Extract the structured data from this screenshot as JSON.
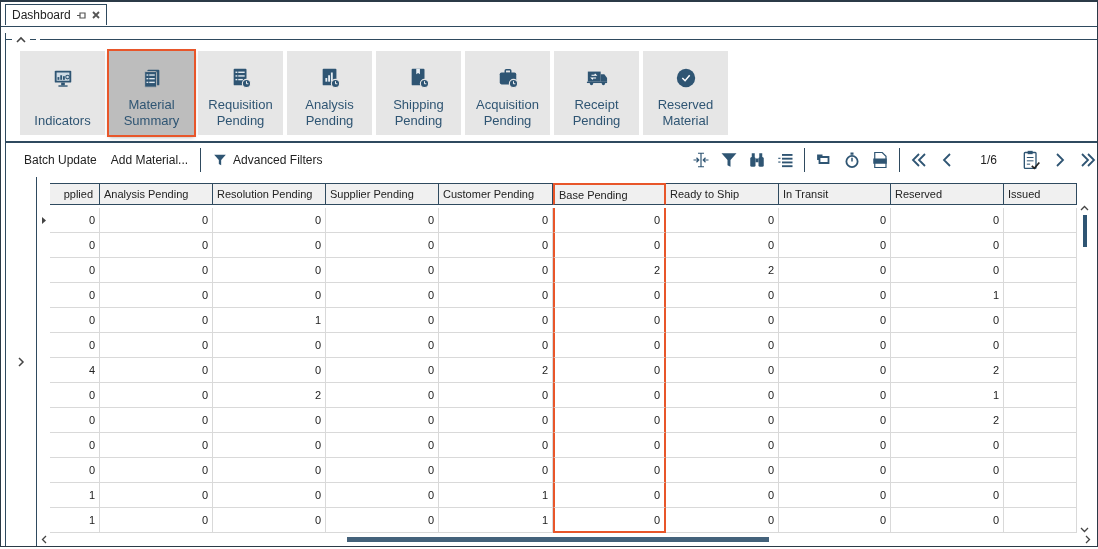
{
  "document_tab": {
    "title": "Dashboard"
  },
  "tiles": [
    {
      "label": "Indicators",
      "selected": false
    },
    {
      "label": "Material Summary",
      "selected": true
    },
    {
      "label": "Requisition Pending",
      "selected": false
    },
    {
      "label": "Analysis Pending",
      "selected": false
    },
    {
      "label": "Shipping Pending",
      "selected": false
    },
    {
      "label": "Acquisition Pending",
      "selected": false
    },
    {
      "label": "Receipt Pending",
      "selected": false
    },
    {
      "label": "Reserved Material",
      "selected": false
    }
  ],
  "toolbar": {
    "buttons": [
      "Batch Update",
      "Add Material..."
    ],
    "filters_button": "Advanced Filters",
    "page": "1/6"
  },
  "table": {
    "columns": [
      {
        "title": "pplied",
        "highlighted": false
      },
      {
        "title": "Analysis Pending",
        "highlighted": false
      },
      {
        "title": "Resolution Pending",
        "highlighted": false
      },
      {
        "title": "Supplier Pending",
        "highlighted": false
      },
      {
        "title": "Customer Pending",
        "highlighted": false
      },
      {
        "title": "Base Pending",
        "highlighted": true
      },
      {
        "title": "Ready to Ship",
        "highlighted": false
      },
      {
        "title": "In Transit",
        "highlighted": false
      },
      {
        "title": "Reserved",
        "highlighted": false
      },
      {
        "title": "Issued",
        "highlighted": false
      }
    ],
    "rows": [
      {
        "current": true,
        "cells": [
          "0",
          "0",
          "0",
          "0",
          "0",
          "0",
          "0",
          "0",
          "0"
        ]
      },
      {
        "current": false,
        "cells": [
          "0",
          "0",
          "0",
          "0",
          "0",
          "0",
          "0",
          "0",
          "0"
        ]
      },
      {
        "current": false,
        "cells": [
          "0",
          "0",
          "0",
          "0",
          "0",
          "2",
          "2",
          "0",
          "0"
        ]
      },
      {
        "current": false,
        "cells": [
          "0",
          "0",
          "0",
          "0",
          "0",
          "0",
          "0",
          "0",
          "1"
        ]
      },
      {
        "current": false,
        "cells": [
          "0",
          "0",
          "1",
          "0",
          "0",
          "0",
          "0",
          "0",
          "0"
        ]
      },
      {
        "current": false,
        "cells": [
          "0",
          "0",
          "0",
          "0",
          "0",
          "0",
          "0",
          "0",
          "0"
        ]
      },
      {
        "current": false,
        "cells": [
          "4",
          "0",
          "0",
          "0",
          "2",
          "0",
          "0",
          "0",
          "2"
        ]
      },
      {
        "current": false,
        "cells": [
          "0",
          "0",
          "2",
          "0",
          "0",
          "0",
          "0",
          "0",
          "1"
        ]
      },
      {
        "current": false,
        "cells": [
          "0",
          "0",
          "0",
          "0",
          "0",
          "0",
          "0",
          "0",
          "2"
        ]
      },
      {
        "current": false,
        "cells": [
          "0",
          "0",
          "0",
          "0",
          "0",
          "0",
          "0",
          "0",
          "0"
        ]
      },
      {
        "current": false,
        "cells": [
          "0",
          "0",
          "0",
          "0",
          "0",
          "0",
          "0",
          "0",
          "0"
        ]
      },
      {
        "current": false,
        "cells": [
          "1",
          "0",
          "0",
          "0",
          "1",
          "0",
          "0",
          "0",
          "0"
        ]
      },
      {
        "current": false,
        "cells": [
          "1",
          "0",
          "0",
          "0",
          "1",
          "0",
          "0",
          "0",
          "0"
        ]
      }
    ]
  }
}
